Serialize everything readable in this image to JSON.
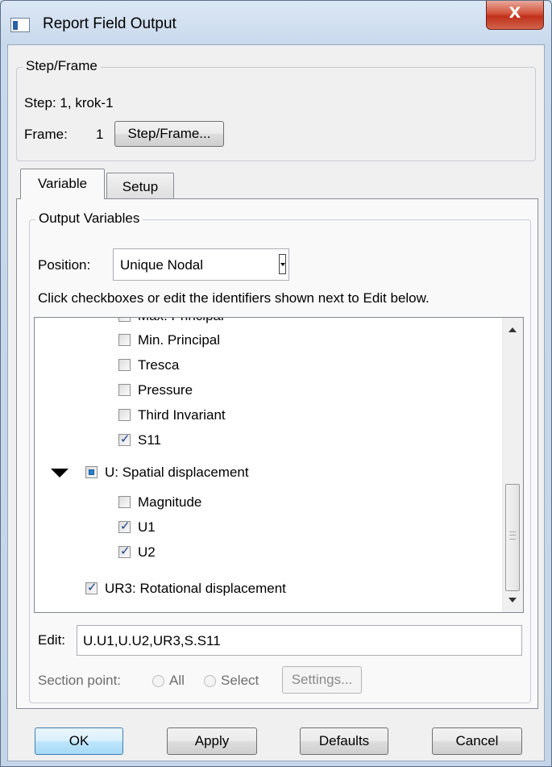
{
  "window": {
    "title": "Report Field Output",
    "close_glyph": "X"
  },
  "step_frame": {
    "group_label": "Step/Frame",
    "step_text": "Step: 1, krok-1",
    "frame_label": "Frame:",
    "frame_value": "1",
    "button_label": "Step/Frame..."
  },
  "tabs": [
    {
      "label": "Variable",
      "active": true
    },
    {
      "label": "Setup",
      "active": false
    }
  ],
  "output_variables": {
    "group_label": "Output Variables",
    "position_label": "Position:",
    "position_value": "Unique Nodal",
    "instructions": "Click checkboxes or edit the identifiers shown next to Edit below."
  },
  "tree": {
    "partial_item": "Max. Principal",
    "items": [
      {
        "label": "Min. Principal",
        "checked": false
      },
      {
        "label": "Tresca",
        "checked": false
      },
      {
        "label": "Pressure",
        "checked": false
      },
      {
        "label": "Third Invariant",
        "checked": false
      },
      {
        "label": "S11",
        "checked": true
      }
    ],
    "u_group": {
      "label": "U: Spatial displacement",
      "state": "partial",
      "expanded": true
    },
    "u_items": [
      {
        "label": "Magnitude",
        "checked": false
      },
      {
        "label": "U1",
        "checked": true
      },
      {
        "label": "U2",
        "checked": true
      }
    ],
    "ur3": {
      "label": "UR3: Rotational displacement",
      "checked": true
    }
  },
  "edit": {
    "label": "Edit:",
    "value": "U.U1,U.U2,UR3,S.S11"
  },
  "section_point": {
    "label": "Section point:",
    "all_label": "All",
    "select_label": "Select",
    "settings_label": "Settings..."
  },
  "buttons": {
    "ok": "OK",
    "apply": "Apply",
    "defaults": "Defaults",
    "cancel": "Cancel"
  },
  "colors": {
    "accent": "#3c7fb1",
    "close": "#c0301a",
    "check": "#1b3f8c",
    "partial": "#2a7fd0"
  }
}
